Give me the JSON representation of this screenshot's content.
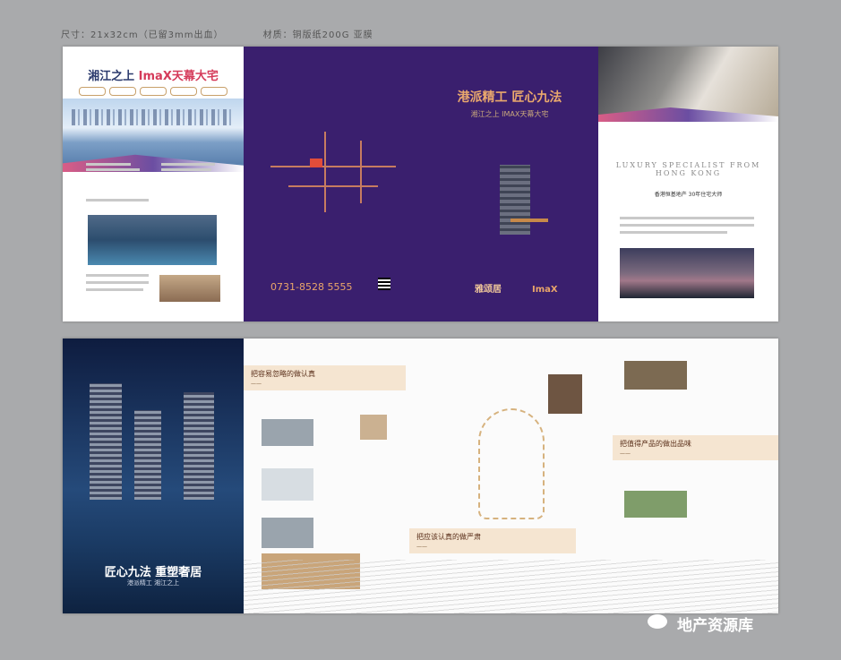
{
  "spec": {
    "size": "尺寸：21x32cm（已留3mm出血）",
    "material": "材质：铜版纸200G 亚膜"
  },
  "panel1": {
    "title_a": "湘江之上",
    "title_b": "ImaX天幕大宅"
  },
  "panel2": {
    "phone": "0731-8528 5555"
  },
  "panel3": {
    "headline": "港派精工 匠心九法",
    "subtitle": "湘江之上 IMAX天幕大宅",
    "logo_a": "雅颂居",
    "logo_b": "ImaX"
  },
  "panel4": {
    "lux_a": "LUXURY SPECIALIST FROM",
    "lux_b": "HONG KONG",
    "line": "香港恒基地产 30年住宅大师"
  },
  "row2": {
    "cover_title": "匠心九法 重塑奢居",
    "cover_sub": "港派精工 湘江之上",
    "tag1": "把容易忽略的做认真",
    "tag2": "把值得产品的做出品味",
    "tag3": "把应该认真的做严肃"
  },
  "watermark": "地产资源库"
}
